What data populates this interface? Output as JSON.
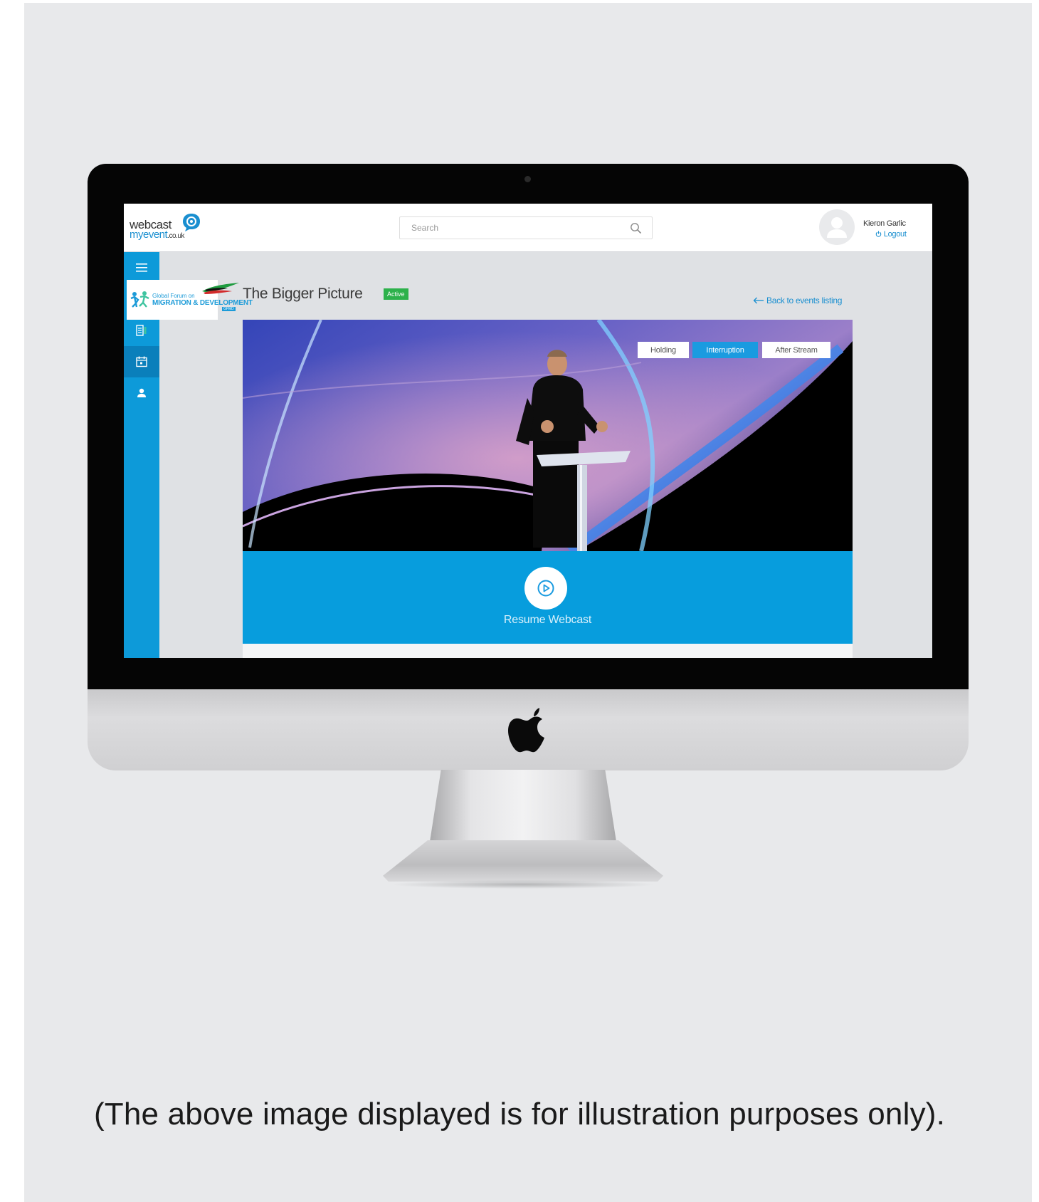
{
  "app": {
    "brand_top": "webcast",
    "brand_bottom": "myevent",
    "brand_suffix": ".co.uk"
  },
  "header": {
    "search_placeholder": "Search",
    "user_name": "Kieron Garlic",
    "logout_label": "Logout"
  },
  "sidebar": {
    "items": [
      {
        "icon": "menu-icon"
      },
      {
        "icon": "speaker-icon"
      },
      {
        "icon": "calendar-icon"
      },
      {
        "icon": "user-icon"
      }
    ]
  },
  "event": {
    "org_logo_line1": "Global Forum on",
    "org_logo_line2": "MIGRATION & DEVELOPMENT",
    "org_logo_line3": "GFMD",
    "title": "The Bigger Picture",
    "status": "Active",
    "back_link": "Back to events listing"
  },
  "video": {
    "buttons": [
      {
        "label": "Holding",
        "state": "default"
      },
      {
        "label": "Interruption",
        "state": "selected"
      },
      {
        "label": "After Stream",
        "state": "default"
      }
    ],
    "resume_label": "Resume Webcast"
  },
  "colors": {
    "accent": "#0d9ad9",
    "status_active": "#2db14b",
    "resume_bar": "#079ddd"
  },
  "caption": "(The above image displayed is for illustration purposes only)."
}
